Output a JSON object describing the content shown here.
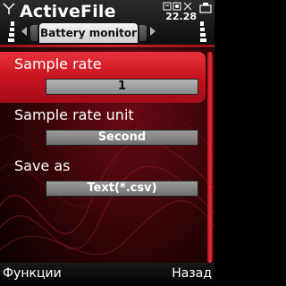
{
  "header": {
    "app_title": "ActiveFile",
    "clock": "22.28",
    "active_tab": "Battery monitor"
  },
  "icons": {
    "signal": "signal-strength-icon",
    "battery": "battery-level-icon",
    "tab_prev": "chevron-left-icon",
    "tab_next": "chevron-right-icon"
  },
  "settings": [
    {
      "label": "Sample rate",
      "value": "1"
    },
    {
      "label": "Sample rate unit",
      "value": "Second"
    },
    {
      "label": "Save as",
      "value": "Text(*.csv)"
    }
  ],
  "softkeys": {
    "left": "Функции",
    "right": "Назад"
  },
  "colors": {
    "accent": "#c4121f",
    "background": "#3a0509"
  }
}
